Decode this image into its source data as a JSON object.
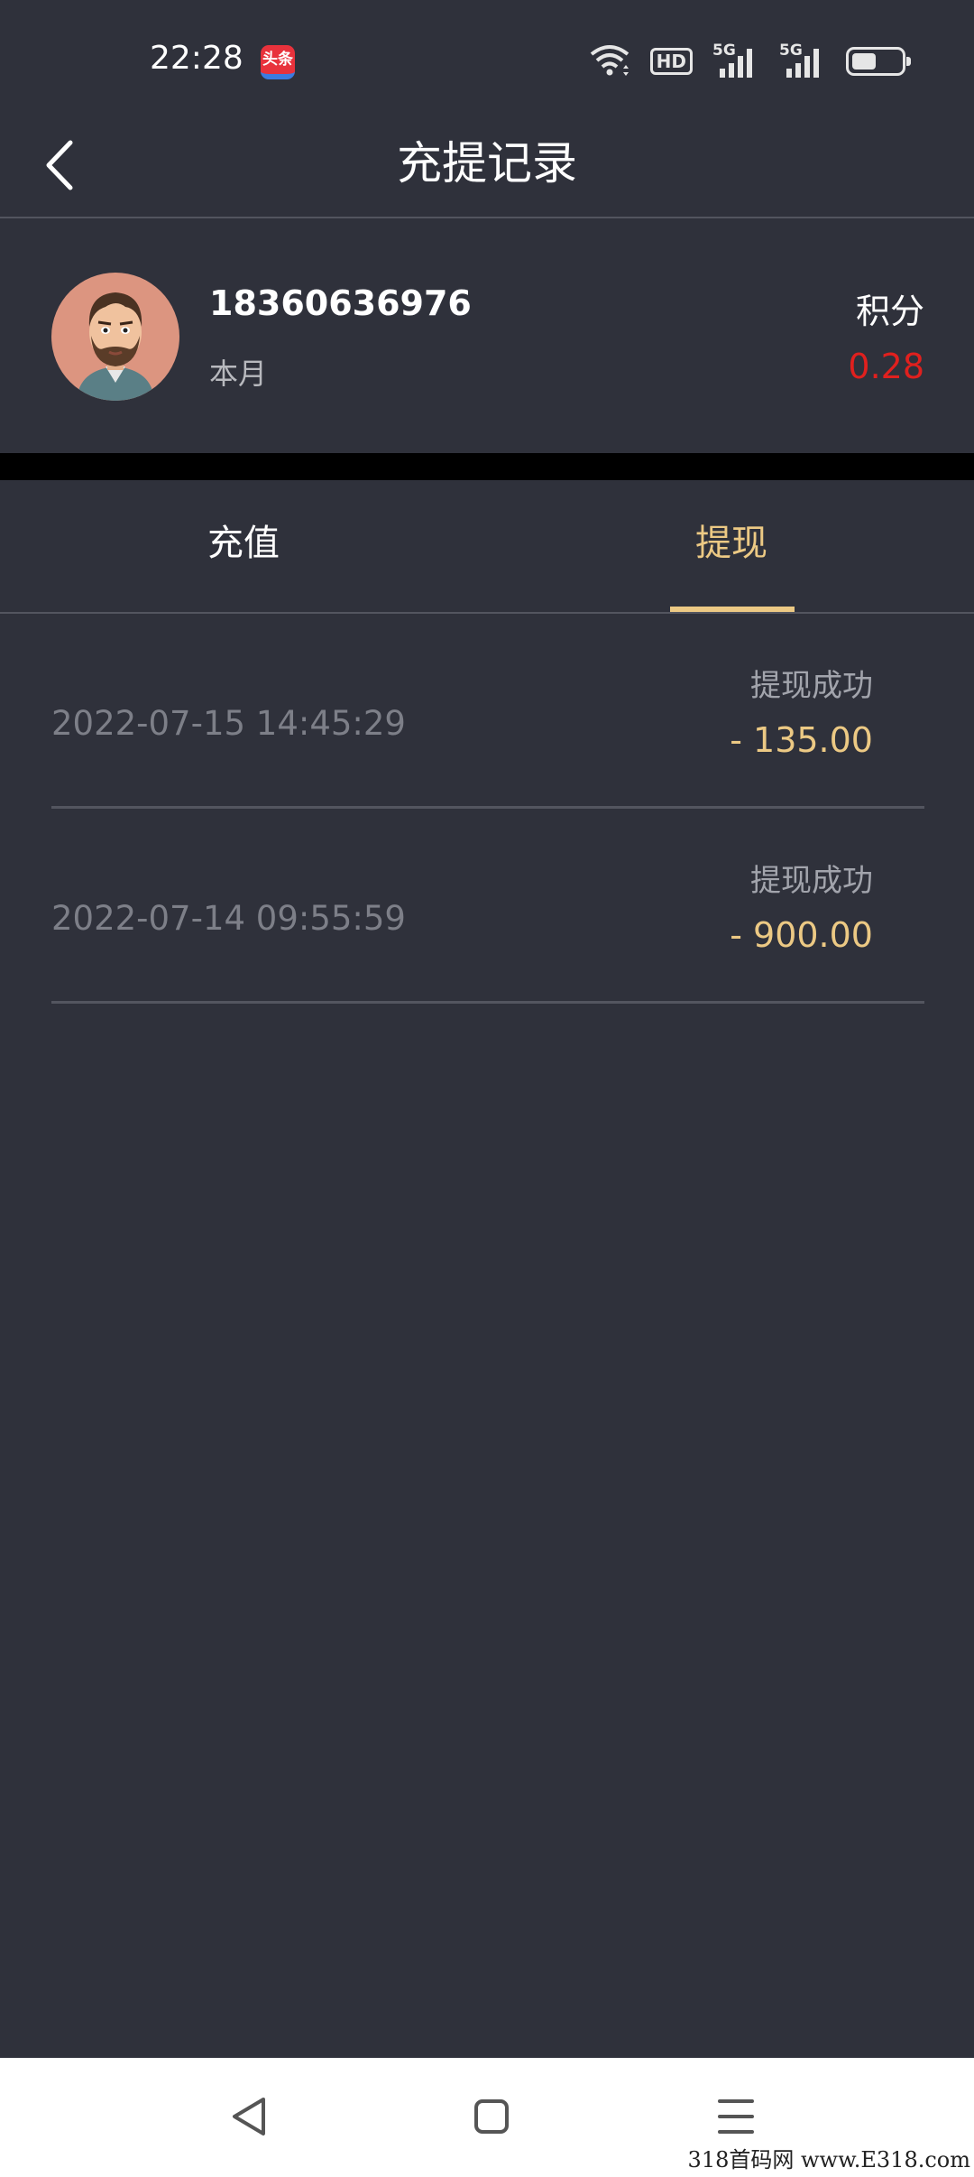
{
  "status_bar": {
    "time": "22:28",
    "app_icon_text": "头条",
    "hd_badge": "HD",
    "sim1_label": "5G",
    "sim2_label": "5G",
    "battery_level": 0.5
  },
  "header": {
    "title": "充提记录"
  },
  "user": {
    "phone": "18360636976",
    "period": "本月",
    "points_label": "积分",
    "points_value": "0.28"
  },
  "tabs": [
    {
      "label": "充值",
      "active": false
    },
    {
      "label": "提现",
      "active": true
    }
  ],
  "records": [
    {
      "time": "2022-07-15 14:45:29",
      "status": "提现成功",
      "amount": "- 135.00"
    },
    {
      "time": "2022-07-14 09:55:59",
      "status": "提现成功",
      "amount": "- 900.00"
    }
  ],
  "watermark": "318首码网 www.E318.com",
  "colors": {
    "background": "#2f313b",
    "accent": "#ecc984",
    "points": "#e0201e"
  }
}
